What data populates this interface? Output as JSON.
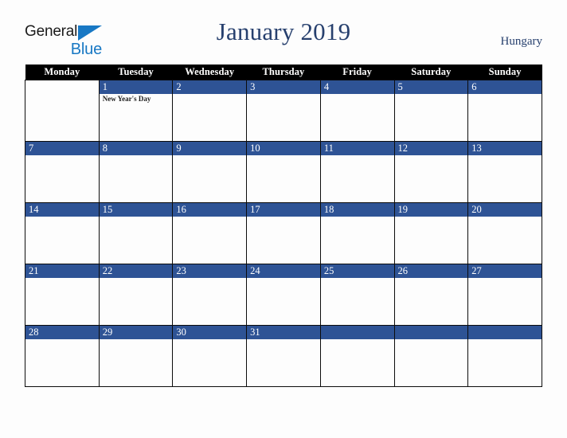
{
  "brand": {
    "line1": "General",
    "line2": "Blue",
    "triangle_color": "#1878c4",
    "text_color": "#1b1b1b"
  },
  "header": {
    "title": "January 2019",
    "country": "Hungary",
    "title_color": "#27406e"
  },
  "calendar": {
    "weekday_headers": [
      "Monday",
      "Tuesday",
      "Wednesday",
      "Thursday",
      "Friday",
      "Saturday",
      "Sunday"
    ],
    "header_bg": "#000000",
    "header_fg": "#ffffff",
    "daynum_bg": "#2e5395",
    "daynum_fg": "#ffffff",
    "cell_bg": "#fdfdfd",
    "grid_line": "#0c0c0c",
    "weeks": [
      [
        {
          "day": "",
          "events": "",
          "empty": true
        },
        {
          "day": "1",
          "events": "New Year's Day",
          "empty": false
        },
        {
          "day": "2",
          "events": "",
          "empty": false
        },
        {
          "day": "3",
          "events": "",
          "empty": false
        },
        {
          "day": "4",
          "events": "",
          "empty": false
        },
        {
          "day": "5",
          "events": "",
          "empty": false
        },
        {
          "day": "6",
          "events": "",
          "empty": false
        }
      ],
      [
        {
          "day": "7",
          "events": "",
          "empty": false
        },
        {
          "day": "8",
          "events": "",
          "empty": false
        },
        {
          "day": "9",
          "events": "",
          "empty": false
        },
        {
          "day": "10",
          "events": "",
          "empty": false
        },
        {
          "day": "11",
          "events": "",
          "empty": false
        },
        {
          "day": "12",
          "events": "",
          "empty": false
        },
        {
          "day": "13",
          "events": "",
          "empty": false
        }
      ],
      [
        {
          "day": "14",
          "events": "",
          "empty": false
        },
        {
          "day": "15",
          "events": "",
          "empty": false
        },
        {
          "day": "16",
          "events": "",
          "empty": false
        },
        {
          "day": "17",
          "events": "",
          "empty": false
        },
        {
          "day": "18",
          "events": "",
          "empty": false
        },
        {
          "day": "19",
          "events": "",
          "empty": false
        },
        {
          "day": "20",
          "events": "",
          "empty": false
        }
      ],
      [
        {
          "day": "21",
          "events": "",
          "empty": false
        },
        {
          "day": "22",
          "events": "",
          "empty": false
        },
        {
          "day": "23",
          "events": "",
          "empty": false
        },
        {
          "day": "24",
          "events": "",
          "empty": false
        },
        {
          "day": "25",
          "events": "",
          "empty": false
        },
        {
          "day": "26",
          "events": "",
          "empty": false
        },
        {
          "day": "27",
          "events": "",
          "empty": false
        }
      ],
      [
        {
          "day": "28",
          "events": "",
          "empty": false
        },
        {
          "day": "29",
          "events": "",
          "empty": false
        },
        {
          "day": "30",
          "events": "",
          "empty": false
        },
        {
          "day": "31",
          "events": "",
          "empty": false
        },
        {
          "day": "",
          "events": "",
          "empty": false
        },
        {
          "day": "",
          "events": "",
          "empty": false
        },
        {
          "day": "",
          "events": "",
          "empty": false
        }
      ]
    ]
  }
}
